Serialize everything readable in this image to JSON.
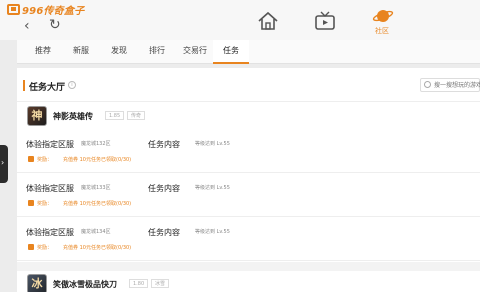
{
  "app": {
    "logo_text": "996传奇盒子",
    "community_label": "社区"
  },
  "tabs": [
    {
      "label": "推荐"
    },
    {
      "label": "新服"
    },
    {
      "label": "发现"
    },
    {
      "label": "排行"
    },
    {
      "label": "交易行"
    },
    {
      "label": "任务",
      "active": true
    }
  ],
  "panel": {
    "title": "任务大厅",
    "search_placeholder": "搜一搜想玩的游戏"
  },
  "games": [
    {
      "name": "神影英雄传",
      "icon_char": "神",
      "version": "1.85",
      "tag": "传奇",
      "tasks": [
        {
          "title": "体验指定区服",
          "server": "魔龙城132区",
          "content_label": "任务内容",
          "content_value": "等级达到 Lv.55",
          "reward_label": "奖励：",
          "reward_value": "充值券 10元",
          "reward_status": "任务已领取(0/30)"
        },
        {
          "title": "体验指定区服",
          "server": "魔龙城133区",
          "content_label": "任务内容",
          "content_value": "等级达到 Lv.55",
          "reward_label": "奖励：",
          "reward_value": "充值券 10元",
          "reward_status": "任务已领取(0/30)"
        },
        {
          "title": "体验指定区服",
          "server": "魔龙城134区",
          "content_label": "任务内容",
          "content_value": "等级达到 Lv.55",
          "reward_label": "奖励：",
          "reward_value": "充值券 10元",
          "reward_status": "任务已领取(0/30)"
        }
      ]
    },
    {
      "name": "笑傲冰雪极品快刀",
      "icon_char": "冰",
      "version": "1.80",
      "tag": "冰雪"
    }
  ],
  "colors": {
    "accent": "#e8841f"
  }
}
